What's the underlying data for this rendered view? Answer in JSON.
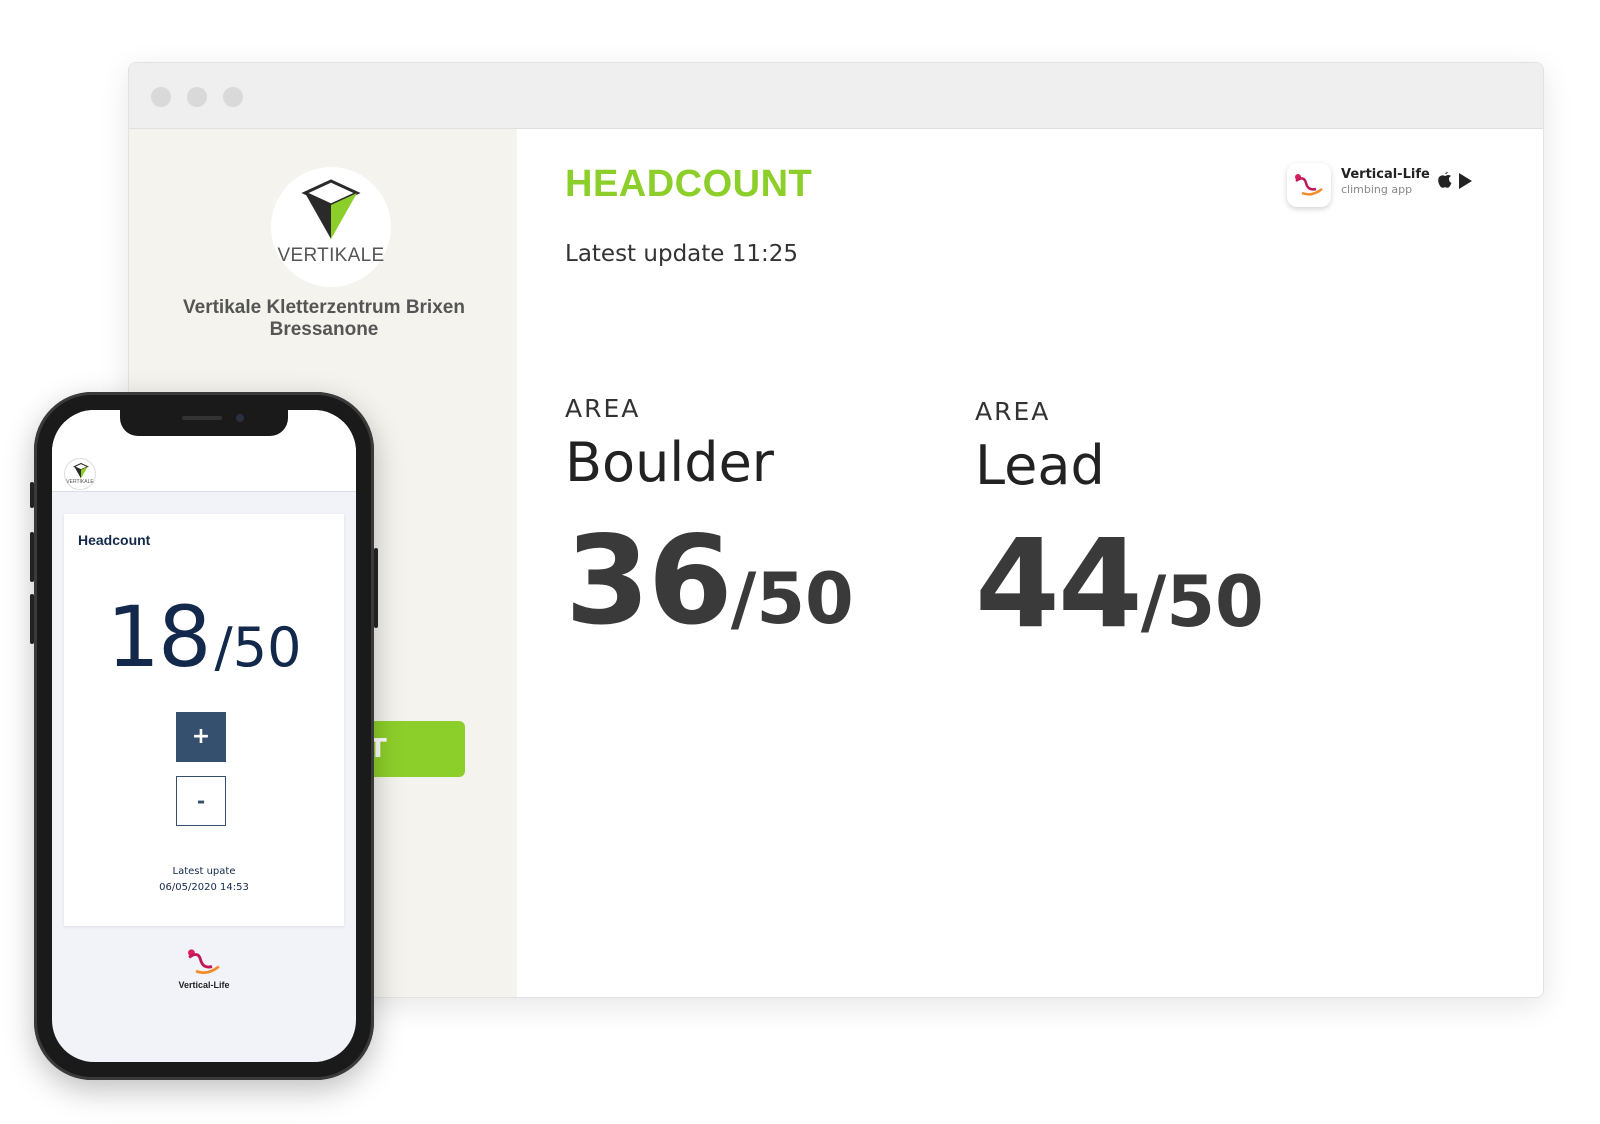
{
  "browser": {
    "logo_text": "VERTIKALE",
    "gym_name_line1": "Vertikale Kletterzentrum Brixen",
    "gym_name_line2": "Bressanone",
    "green_button_label": "T",
    "title": "HEADCOUNT",
    "latest_update": "Latest update 11:25",
    "app_badge": {
      "name": "Vertical-Life",
      "subtitle": "climbing app",
      "icons": [
        "apple-icon",
        "play-store-icon"
      ]
    },
    "areas": [
      {
        "label": "AREA",
        "name": "Boulder",
        "count": "36",
        "capacity": "/50"
      },
      {
        "label": "AREA",
        "name": "Lead",
        "count": "44",
        "capacity": "/50"
      }
    ],
    "accent_color": "#8dcf2a"
  },
  "phone": {
    "logo_text": "VERTIKALE",
    "card_title": "Headcount",
    "count": "18",
    "capacity": "/50",
    "plus_label": "+",
    "minus_label": "-",
    "latest_label": "Latest upate",
    "latest_value": "06/05/2020 14:53",
    "footer_brand": "Vertical-Life",
    "primary_color": "#13294b"
  }
}
